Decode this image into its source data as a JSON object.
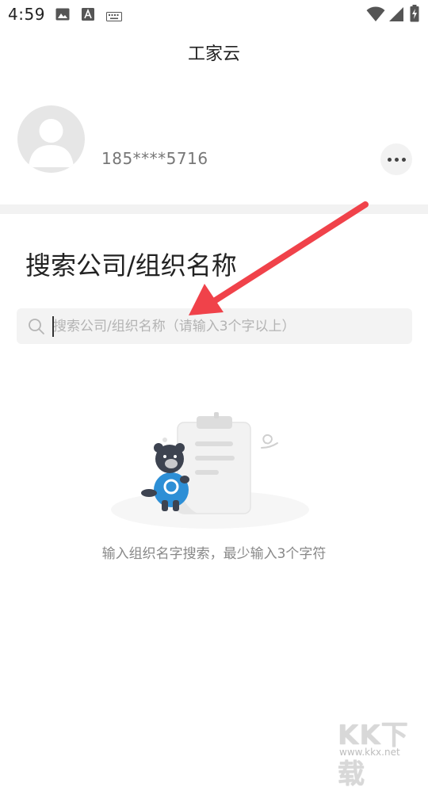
{
  "status_bar": {
    "time": "4:59",
    "left_icons": [
      "image-icon",
      "text-a-icon",
      "keyboard-icon"
    ],
    "right_icons": [
      "wifi-icon",
      "signal-icon",
      "battery-charging-icon"
    ]
  },
  "header": {
    "title": "工家云"
  },
  "profile": {
    "phone": "185****5716",
    "more_icon": "more-dots-icon"
  },
  "search": {
    "section_title": "搜索公司/组织名称",
    "placeholder": "搜索公司/组织名称（请输入3个字以上）",
    "value": ""
  },
  "empty_state": {
    "message": "输入组织名字搜索，最少输入3个字符"
  },
  "watermark": {
    "logo_text": "KK下载",
    "url": "www.kkx.net"
  },
  "colors": {
    "annotation_arrow": "#f0424a",
    "mascot_accent": "#2d8fd6",
    "background": "#ffffff",
    "search_bg": "#f3f3f3"
  }
}
